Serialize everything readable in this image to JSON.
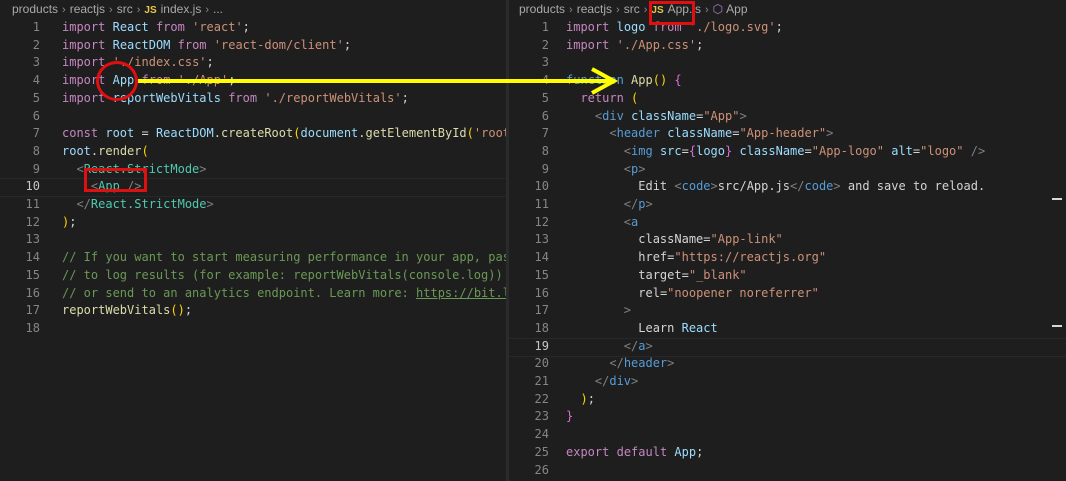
{
  "left_editor": {
    "breadcrumb": [
      "products",
      "reactjs",
      "src",
      "index.js",
      "..."
    ],
    "file_icon": "JS",
    "active_line": 10,
    "lines": [
      {
        "n": "1",
        "code": "import React from 'react';"
      },
      {
        "n": "2",
        "code": "import ReactDOM from 'react-dom/client';"
      },
      {
        "n": "3",
        "code": "import './index.css';"
      },
      {
        "n": "4",
        "code": "import App from './App';"
      },
      {
        "n": "5",
        "code": "import reportWebVitals from './reportWebVitals';"
      },
      {
        "n": "6",
        "code": ""
      },
      {
        "n": "7",
        "code": "const root = ReactDOM.createRoot(document.getElementById('root'));"
      },
      {
        "n": "8",
        "code": "root.render("
      },
      {
        "n": "9",
        "code": "  <React.StrictMode>"
      },
      {
        "n": "10",
        "code": "    <App />"
      },
      {
        "n": "11",
        "code": "  </React.StrictMode>"
      },
      {
        "n": "12",
        "code": ");"
      },
      {
        "n": "13",
        "code": ""
      },
      {
        "n": "14",
        "code": "// If you want to start measuring performance in your app, pass a"
      },
      {
        "n": "15",
        "code": "// to log results (for example: reportWebVitals(console.log))"
      },
      {
        "n": "16",
        "code": "// or send to an analytics endpoint. Learn more: https://bit.ly/C"
      },
      {
        "n": "17",
        "code": "reportWebVitals();"
      },
      {
        "n": "18",
        "code": ""
      }
    ]
  },
  "right_editor": {
    "breadcrumb": [
      "products",
      "reactjs",
      "src",
      "App.js",
      "App"
    ],
    "file_icon": "JS",
    "active_line": 19,
    "lines": [
      {
        "n": "1",
        "code": "import logo from './logo.svg';"
      },
      {
        "n": "2",
        "code": "import './App.css';"
      },
      {
        "n": "3",
        "code": ""
      },
      {
        "n": "4",
        "code": "function App() {"
      },
      {
        "n": "5",
        "code": "  return ("
      },
      {
        "n": "6",
        "code": "    <div className=\"App\">"
      },
      {
        "n": "7",
        "code": "      <header className=\"App-header\">"
      },
      {
        "n": "8",
        "code": "        <img src={logo} className=\"App-logo\" alt=\"logo\" />"
      },
      {
        "n": "9",
        "code": "        <p>"
      },
      {
        "n": "10",
        "code": "          Edit <code>src/App.js</code> and save to reload."
      },
      {
        "n": "11",
        "code": "        </p>"
      },
      {
        "n": "12",
        "code": "        <a"
      },
      {
        "n": "13",
        "code": "          className=\"App-link\""
      },
      {
        "n": "14",
        "code": "          href=\"https://reactjs.org\""
      },
      {
        "n": "15",
        "code": "          target=\"_blank\""
      },
      {
        "n": "16",
        "code": "          rel=\"noopener noreferrer\""
      },
      {
        "n": "17",
        "code": "        >"
      },
      {
        "n": "18",
        "code": "          Learn React"
      },
      {
        "n": "19",
        "code": "        </a>"
      },
      {
        "n": "20",
        "code": "      </header>"
      },
      {
        "n": "21",
        "code": "    </div>"
      },
      {
        "n": "22",
        "code": "  );"
      },
      {
        "n": "23",
        "code": "}"
      },
      {
        "n": "24",
        "code": ""
      },
      {
        "n": "25",
        "code": "export default App;"
      },
      {
        "n": "26",
        "code": ""
      }
    ]
  },
  "colors": {
    "background": "#1e1e1e",
    "annotation": "#e01010",
    "arrow": "#ffff00"
  }
}
